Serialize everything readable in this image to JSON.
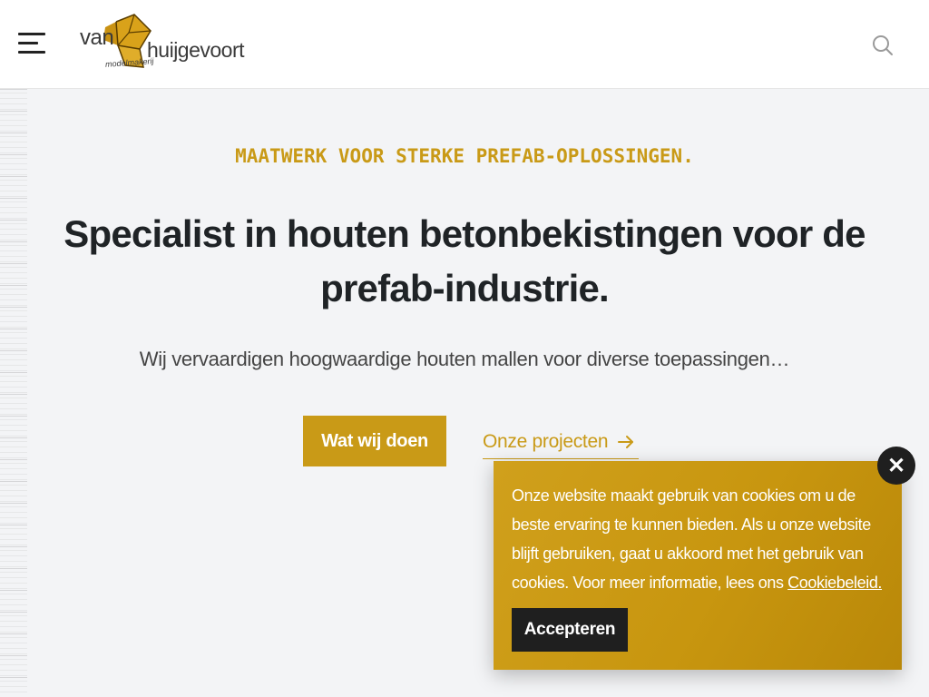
{
  "header": {
    "menu_icon": "hamburger-menu-icon",
    "logo": {
      "van": "van",
      "name": "huijgevoort",
      "sub": "modelmakerij",
      "mark_color": "#d9a21a"
    },
    "search_icon": "search-icon"
  },
  "hero": {
    "eyebrow": "MAATWERK VOOR STERKE PREFAB-OPLOSSINGEN.",
    "headline": "Specialist in houten betonbekistingen voor de prefab-industrie.",
    "intro": "Wij vervaardigen hoogwaardige houten mallen voor diverse toepassingen…",
    "primary_button": "Wat wij doen",
    "secondary_link": "Onze projecten",
    "secondary_icon": "arrow-right-icon"
  },
  "cookie": {
    "text": "Onze website maakt gebruik van cookies om u de beste ervaring te kunnen bieden. Als u onze website blijft gebruiken, gaat u akkoord met het gebruik van cookies. Voor meer informatie, lees ons ",
    "link": "Cookiebeleid.",
    "accept": "Accepteren",
    "close_icon": "close-icon",
    "close_glyph": "✕"
  },
  "colors": {
    "accent": "#c99a17",
    "dark": "#1f1f1f",
    "background": "#f3f4f6"
  }
}
